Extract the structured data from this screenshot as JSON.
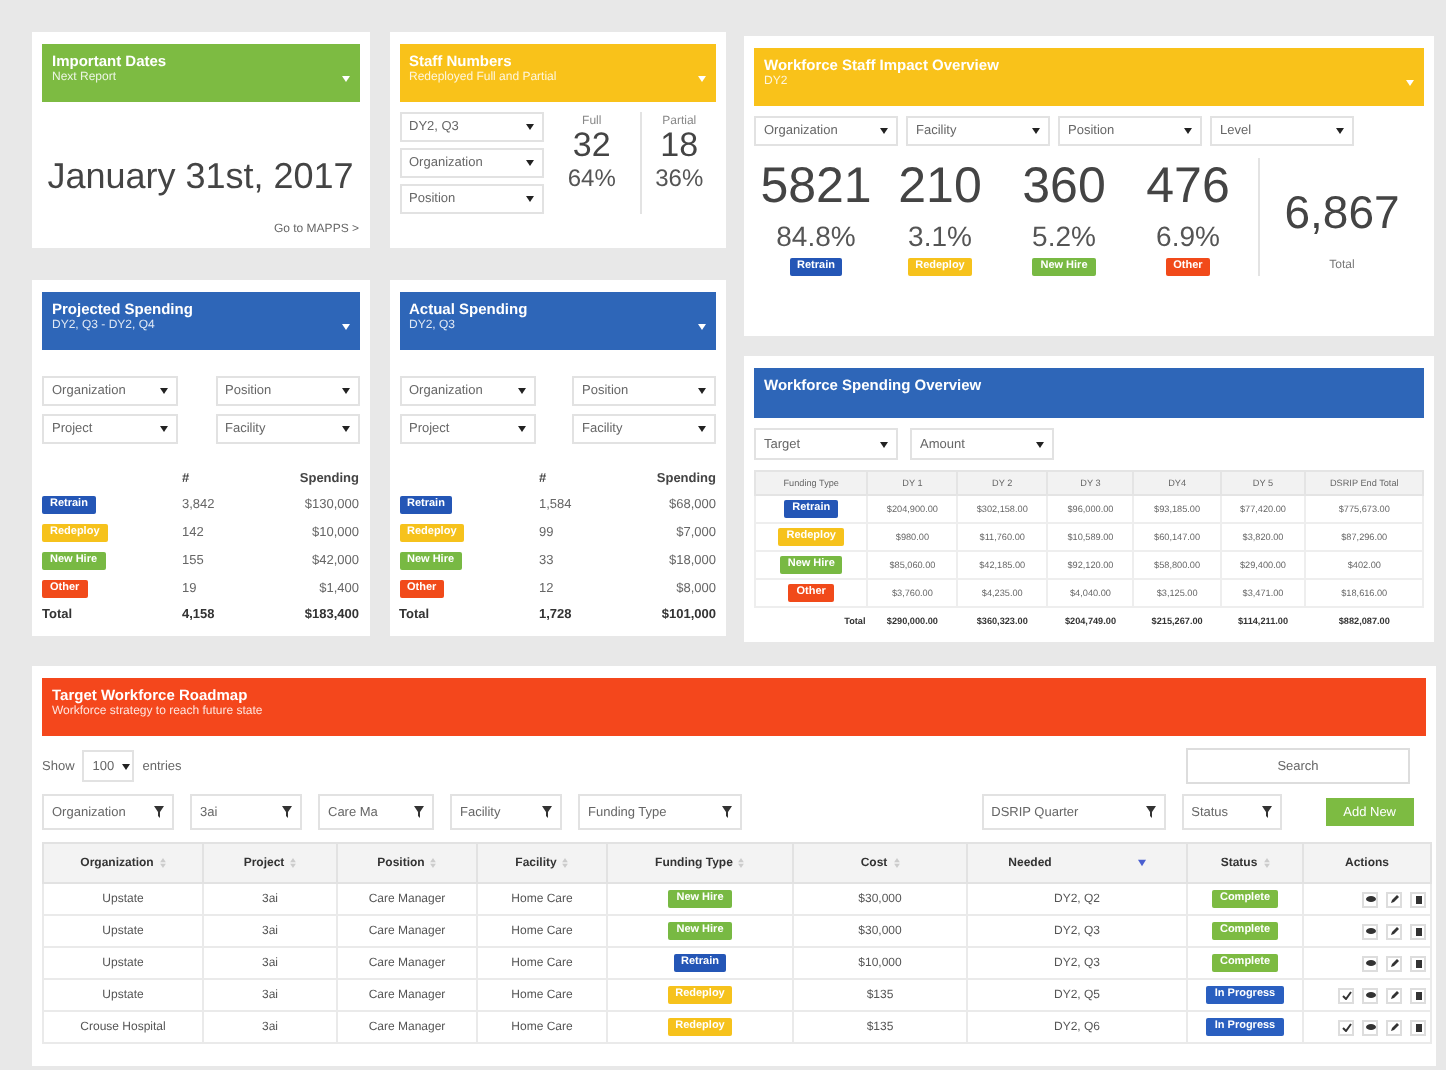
{
  "important_dates": {
    "title": "Important Dates",
    "subtitle": "Next Report",
    "dropdown": true,
    "date": "January 31st, 2017",
    "link": "Go to MAPPS >"
  },
  "staff_numbers": {
    "title": "Staff Numbers",
    "subtitle": "Redeployed Full and Partial",
    "dropdown": true,
    "filters": [
      "DY2, Q3",
      "Organization",
      "Position"
    ],
    "stats": [
      {
        "label": "Full",
        "count": "32",
        "percent": "64%"
      },
      {
        "label": "Partial",
        "count": "18",
        "percent": "36%"
      }
    ]
  },
  "projected_spending": {
    "title": "Projected Spending",
    "subtitle": "DY2, Q3 - DY2, Q4",
    "dropdown": true,
    "filters": [
      "Organization",
      "Position",
      "Project",
      "Facility"
    ],
    "columns": [
      "#",
      "Spending"
    ],
    "rows": [
      {
        "type": {
          "label": "Retrain",
          "color": "#2456b6"
        },
        "count": "3,842",
        "spending": "$130,000"
      },
      {
        "type": {
          "label": "Redeploy",
          "color": "#f6c21c"
        },
        "count": "142",
        "spending": "$10,000"
      },
      {
        "type": {
          "label": "New Hire",
          "color": "#78b943"
        },
        "count": "155",
        "spending": "$42,000"
      },
      {
        "type": {
          "label": "Other",
          "color": "#f14a1a"
        },
        "count": "19",
        "spending": "$1,400"
      }
    ],
    "total": {
      "label": "Total",
      "count": "4,158",
      "spending": "$183,400"
    }
  },
  "actual_spending": {
    "title": "Actual Spending",
    "subtitle": "DY2, Q3",
    "dropdown": true,
    "filters": [
      "Organization",
      "Position",
      "Project",
      "Facility"
    ],
    "columns": [
      "#",
      "Spending"
    ],
    "rows": [
      {
        "type": {
          "label": "Retrain",
          "color": "#2456b6"
        },
        "count": "1,584",
        "spending": "$68,000"
      },
      {
        "type": {
          "label": "Redeploy",
          "color": "#f6c21c"
        },
        "count": "99",
        "spending": "$7,000"
      },
      {
        "type": {
          "label": "New Hire",
          "color": "#78b943"
        },
        "count": "33",
        "spending": "$18,000"
      },
      {
        "type": {
          "label": "Other",
          "color": "#f14a1a"
        },
        "count": "12",
        "spending": "$8,000"
      }
    ],
    "total": {
      "label": "Total",
      "count": "1,728",
      "spending": "$101,000"
    }
  },
  "staff_impact": {
    "title": "Workforce Staff Impact Overview",
    "subtitle": "DY2",
    "dropdown": true,
    "filters": [
      "Organization",
      "Facility",
      "Position",
      "Level"
    ],
    "stats": [
      {
        "count": "5821",
        "percent": "84.8%",
        "type": {
          "label": "Retrain",
          "color": "#2456b6"
        }
      },
      {
        "count": "210",
        "percent": "3.1%",
        "type": {
          "label": "Redeploy",
          "color": "#f6c21c"
        }
      },
      {
        "count": "360",
        "percent": "5.2%",
        "type": {
          "label": "New Hire",
          "color": "#78b943"
        }
      },
      {
        "count": "476",
        "percent": "6.9%",
        "type": {
          "label": "Other",
          "color": "#f14a1a"
        }
      }
    ],
    "total": {
      "value": "6,867",
      "label": "Total"
    }
  },
  "spending_overview": {
    "title": "Workforce Spending Overview",
    "dropdown": false,
    "filters": [
      "Target",
      "Amount"
    ],
    "columns": [
      "Funding Type",
      "DY 1",
      "DY 2",
      "DY 3",
      "DY4",
      "DY 5",
      "DSRIP End Total"
    ],
    "rows": [
      {
        "type": {
          "label": "Retrain",
          "color": "#2456b6"
        },
        "values": [
          "$204,900.00",
          "$302,158.00",
          "$96,000.00",
          "$93,185.00",
          "$77,420.00",
          "$775,673.00"
        ]
      },
      {
        "type": {
          "label": "Redeploy",
          "color": "#f6c21c"
        },
        "values": [
          "$980.00",
          "$11,760.00",
          "$10,589.00",
          "$60,147.00",
          "$3,820.00",
          "$87,296.00"
        ]
      },
      {
        "type": {
          "label": "New Hire",
          "color": "#78b943"
        },
        "values": [
          "$85,060.00",
          "$42,185.00",
          "$92,120.00",
          "$58,800.00",
          "$29,400.00",
          "$402.00"
        ]
      },
      {
        "type": {
          "label": "Other",
          "color": "#f14a1a"
        },
        "values": [
          "$3,760.00",
          "$4,235.00",
          "$4,040.00",
          "$3,125.00",
          "$3,471.00",
          "$18,616.00"
        ]
      }
    ],
    "total": {
      "label": "Total",
      "values": [
        "$290,000.00",
        "$360,323.00",
        "$204,749.00",
        "$215,267.00",
        "$114,211.00",
        "$882,087.00"
      ]
    }
  },
  "roadmap": {
    "title": "Target Workforce Roadmap",
    "subtitle": "Workforce strategy to reach future state",
    "dropdown": false,
    "show_label": "Show",
    "page_size": "100",
    "entries_label": "entries",
    "search": {
      "placeholder": "Search"
    },
    "filters": [
      "Organization",
      "3ai",
      "Care Ma",
      "Facility",
      "Funding Type",
      "DSRIP Quarter",
      "Status"
    ],
    "add_button": "Add New",
    "table": {
      "columns": [
        {
          "label": "Organization",
          "kind": "sortable"
        },
        {
          "label": "Project",
          "kind": "sortable"
        },
        {
          "label": "Position",
          "kind": "sortable"
        },
        {
          "label": "Facility",
          "kind": "sortable"
        },
        {
          "label": "Funding Type",
          "kind": "sortable"
        },
        {
          "label": "Cost",
          "kind": "sortable"
        },
        {
          "label": "Needed",
          "kind": "sorted"
        },
        {
          "label": "Status",
          "kind": "sortable"
        },
        {
          "label": "Actions",
          "kind": "plain"
        }
      ],
      "rows": [
        {
          "organization": "Upstate",
          "project": "3ai",
          "position": "Care Manager",
          "facility": "Home Care",
          "funding_type": {
            "label": "New Hire",
            "color": "#78b943"
          },
          "cost": "$30,000",
          "needed": "DY2, Q2",
          "status": {
            "label": "Complete",
            "color": "#7dbb42"
          },
          "approvable": false
        },
        {
          "organization": "Upstate",
          "project": "3ai",
          "position": "Care Manager",
          "facility": "Home Care",
          "funding_type": {
            "label": "New Hire",
            "color": "#78b943"
          },
          "cost": "$30,000",
          "needed": "DY2, Q3",
          "status": {
            "label": "Complete",
            "color": "#7dbb42"
          },
          "approvable": false
        },
        {
          "organization": "Upstate",
          "project": "3ai",
          "position": "Care Manager",
          "facility": "Home Care",
          "funding_type": {
            "label": "Retrain",
            "color": "#2456b6"
          },
          "cost": "$10,000",
          "needed": "DY2, Q3",
          "status": {
            "label": "Complete",
            "color": "#7dbb42"
          },
          "approvable": false
        },
        {
          "organization": "Upstate",
          "project": "3ai",
          "position": "Care Manager",
          "facility": "Home Care",
          "funding_type": {
            "label": "Redeploy",
            "color": "#f6c21c"
          },
          "cost": "$135",
          "needed": "DY2, Q5",
          "status": {
            "label": "In Progress",
            "color": "#2a5fc0"
          },
          "approvable": true
        },
        {
          "organization": "Crouse Hospital",
          "project": "3ai",
          "position": "Care Manager",
          "facility": "Home Care",
          "funding_type": {
            "label": "Redeploy",
            "color": "#f6c21c"
          },
          "cost": "$135",
          "needed": "DY2, Q6",
          "status": {
            "label": "In Progress",
            "color": "#2a5fc0"
          },
          "approvable": true
        }
      ]
    }
  }
}
